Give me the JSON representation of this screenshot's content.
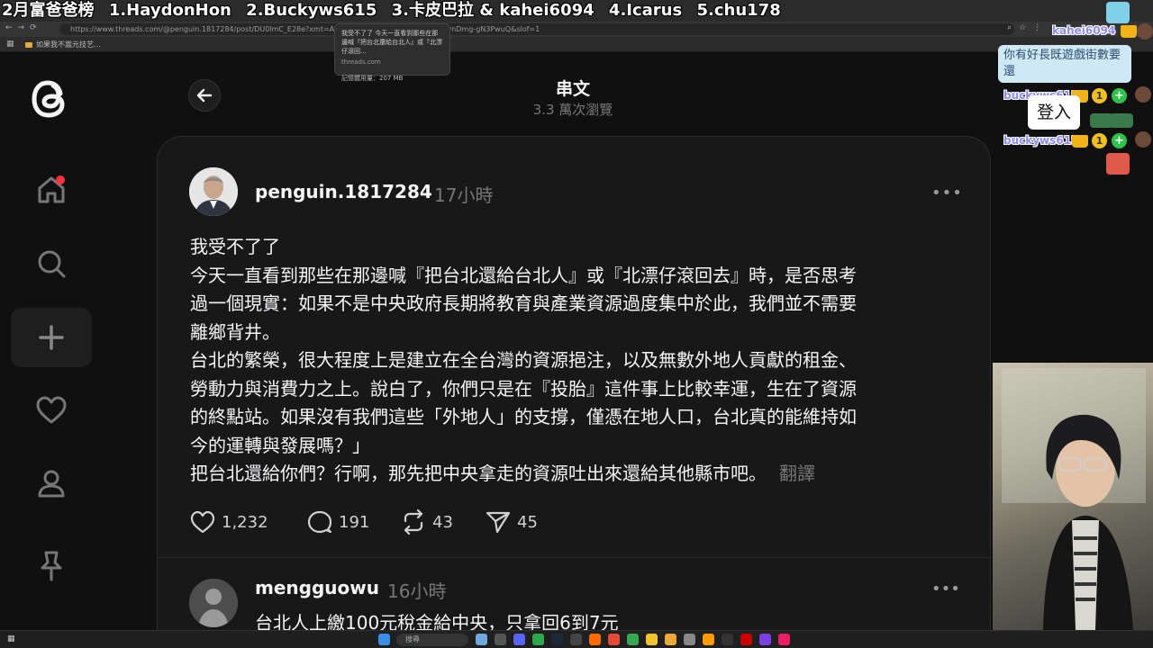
{
  "overlay": {
    "ranking": [
      "2月富爸爸榜",
      "1.HaydonHon",
      "2.Buckyws615",
      "3.卡皮巴拉 & kahei6094",
      "4.Icarus",
      "5.chu178"
    ]
  },
  "browser": {
    "url": "https://www.threads.com/@penguin.1817284/post/DU0lmC_E28e?xmt=AQF0I3OsOri9v3...18Y1zzNZleITfvnDmg-gN3PwuQ&slof=1",
    "bookmark": "如果我不嵩元技艺...",
    "tooltip": {
      "title": "我受不了了 今天一直看到那些在那邊喊『把台北還給台北人』或『北漂仔滾回...",
      "host": "threads.com",
      "memory": "記憶體用量：207 MB"
    }
  },
  "header": {
    "title": "串文",
    "views": "3.3 萬次瀏覽"
  },
  "post": {
    "username": "penguin.1817284",
    "time": "17小時",
    "lines": [
      "我受不了了",
      "今天一直看到那些在那邊喊『把台北還給台北人』或『北漂仔滾回去』時，是否思考",
      "過一個現實：如果不是中央政府長期將教育與產業資源過度集中於此，我們並不需要",
      "離鄉背井。",
      "台北的繁榮，很大程度上是建立在全台灣的資源挹注，以及無數外地人貢獻的租金、",
      "勞動力與消費力之上。說白了，你們只是在『投胎』這件事上比較幸運，生在了資源",
      "的終點站。如果沒有我們這些「外地人」的支撐，僅憑在地人口，台北真的能維持如",
      "今的運轉與發展嗎？」",
      "把台北還給你們？行啊，那先把中央拿走的資源吐出來還給其他縣市吧。"
    ],
    "translate": "翻譯",
    "likes": "1,232",
    "comments": "191",
    "reposts": "43",
    "shares": "45"
  },
  "reply": {
    "username": "mengguowu",
    "time": "16小時",
    "text": "台北人上繳100元稅金給中央，只拿回6到7元"
  },
  "chat": {
    "user1": "kahei6094",
    "msg1": "你有好長既遊戲街數要還",
    "user2": "buckyws615",
    "msg2": "登入",
    "user3": "buckyws615",
    "badge_number": "1",
    "badge_plus": "+"
  },
  "taskbar": {
    "search": "搜尋"
  },
  "colors": {
    "background": "#101010",
    "card": "#181818",
    "notification": "#ff3040",
    "chat_user": "#8e8cf2",
    "chat_bubble": "#cfe9f4"
  }
}
